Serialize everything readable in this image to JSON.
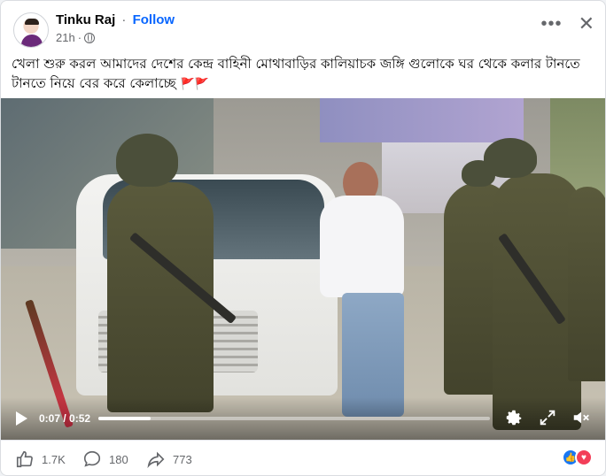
{
  "post": {
    "author": "Tinku Raj",
    "separator": "·",
    "follow_label": "Follow",
    "time": "21h",
    "separator2": "·",
    "caption": "খেলা শুরু করল আমাদের দেশের কেন্দ্র বাহিনী মোথাবাড়ির কালিয়াচক জঙ্গি গুলোকে ঘর থেকে কলার টানতে টানতে নিয়ে বের করে কেলাচ্ছে",
    "caption_emoji": "🚩🚩",
    "more_icon": "more-horizontal-icon",
    "close_icon": "close-icon"
  },
  "video": {
    "time_display": "0:07 / 0:52",
    "progress_fraction": 0.1346,
    "icons": [
      "play-icon",
      "settings-icon",
      "fullscreen-icon",
      "mute-icon"
    ]
  },
  "footer": {
    "likes": "1.7K",
    "comments": "180",
    "shares": "773",
    "reactions": [
      "like",
      "love"
    ]
  },
  "colors": {
    "accent": "#0866ff",
    "secondary_text": "#65676b",
    "like_blue": "#1877f2",
    "love_red": "#f33e58"
  }
}
